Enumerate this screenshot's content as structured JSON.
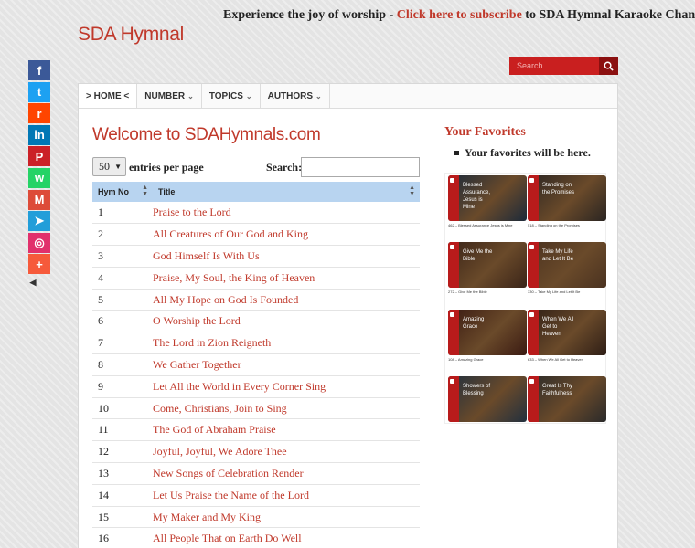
{
  "topbar": {
    "prefix": "Experience the joy of worship - ",
    "link": "Click here to subscribe",
    "suffix": " to SDA Hymnal Karaoke Channel!"
  },
  "site_title": "SDA Hymnal",
  "search": {
    "placeholder": "Search"
  },
  "share": [
    {
      "name": "facebook",
      "glyph": "f",
      "color": "#3b5998"
    },
    {
      "name": "twitter",
      "glyph": "t",
      "color": "#1da1f2"
    },
    {
      "name": "reddit",
      "glyph": "r",
      "color": "#ff4500"
    },
    {
      "name": "linkedin",
      "glyph": "in",
      "color": "#0077b5"
    },
    {
      "name": "pinterest",
      "glyph": "P",
      "color": "#cb2027"
    },
    {
      "name": "whatsapp",
      "glyph": "w",
      "color": "#25d366"
    },
    {
      "name": "gmail",
      "glyph": "M",
      "color": "#dd4b39"
    },
    {
      "name": "telegram",
      "glyph": "➤",
      "color": "#229ed9"
    },
    {
      "name": "instagram",
      "glyph": "◎",
      "color": "#e1306c"
    },
    {
      "name": "more",
      "glyph": "+",
      "color": "#f65a3b"
    }
  ],
  "nav": [
    {
      "label": "> HOME <",
      "active": true,
      "chevron": false
    },
    {
      "label": "NUMBER",
      "active": false,
      "chevron": true
    },
    {
      "label": "TOPICS",
      "active": false,
      "chevron": true
    },
    {
      "label": "AUTHORS",
      "active": false,
      "chevron": true
    }
  ],
  "main": {
    "heading": "Welcome to SDAHymnals.com",
    "length_value": "50",
    "length_label": "entries per page",
    "search_label": "Search:",
    "columns": [
      "Hym No",
      "Title"
    ],
    "rows": [
      {
        "num": "1",
        "title": "Praise to the Lord"
      },
      {
        "num": "2",
        "title": "All Creatures of Our God and King"
      },
      {
        "num": "3",
        "title": "God Himself Is With Us"
      },
      {
        "num": "4",
        "title": "Praise, My Soul, the King of Heaven"
      },
      {
        "num": "5",
        "title": "All My Hope on God Is Founded"
      },
      {
        "num": "6",
        "title": "O Worship the Lord"
      },
      {
        "num": "7",
        "title": "The Lord in Zion Reigneth"
      },
      {
        "num": "8",
        "title": "We Gather Together"
      },
      {
        "num": "9",
        "title": "Let All the World in Every Corner Sing"
      },
      {
        "num": "10",
        "title": "Come, Christians, Join to Sing"
      },
      {
        "num": "11",
        "title": "The God of Abraham Praise"
      },
      {
        "num": "12",
        "title": "Joyful, Joyful, We Adore Thee"
      },
      {
        "num": "13",
        "title": "New Songs of Celebration Render"
      },
      {
        "num": "14",
        "title": "Let Us Praise the Name of the Lord"
      },
      {
        "num": "15",
        "title": "My Maker and My King"
      },
      {
        "num": "16",
        "title": "All People That on Earth Do Well"
      }
    ]
  },
  "sidebar": {
    "title": "Your Favorites",
    "placeholder": "Your favorites will be here.",
    "thumbs": [
      {
        "text": "Blessed Assurance, Jesus is Mine",
        "caption": "462 – Blessed Assurance Jesus is Mine",
        "bg": "#1c2a3a"
      },
      {
        "text": "Standing on the Promises",
        "caption": "518 – Standing on the Promises",
        "bg": "#2a2522"
      },
      {
        "text": "Give Me the Bible",
        "caption": "272 – Give Me the Bible",
        "bg": "#3a2418"
      },
      {
        "text": "Take My Life and Let It Be",
        "caption": "330 – Take My Life and Let It Be",
        "bg": "#4a3220"
      },
      {
        "text": "Amazing Grace",
        "caption": "108 – Amazing Grace",
        "bg": "#3a1a12"
      },
      {
        "text": "When We All Get to Heaven",
        "caption": "633 – When We All Get to Heaven",
        "bg": "#2e1e16"
      },
      {
        "text": "Showers of Blessing",
        "caption": "",
        "bg": "#22303e"
      },
      {
        "text": "Great Is Thy Faithfulness",
        "caption": "",
        "bg": "#2a2a2a"
      }
    ]
  }
}
